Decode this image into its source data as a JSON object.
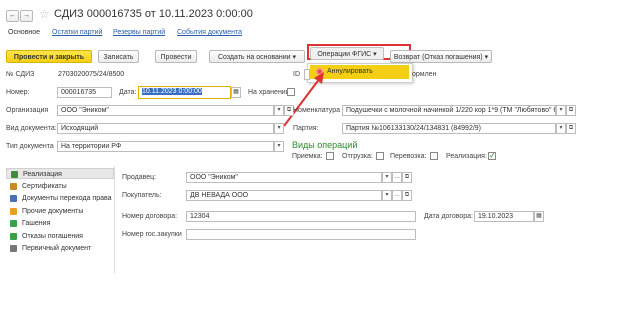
{
  "nav": {
    "back": "←",
    "forward": "→"
  },
  "title": "СДИЗ 000016735 от 10.11.2023 0:00:00",
  "tabs": [
    "Основное",
    "Остатки партий",
    "Резервы партий",
    "События документа"
  ],
  "toolbar": {
    "post_close": "Провести и закрыть",
    "save": "Записать",
    "post": "Провести",
    "create_based": "Создать на основании",
    "fgis_ops": "Операции ФГИС",
    "return": "Возврат (Отказ погашения)"
  },
  "dropdown": {
    "cancel": "Аннулировать"
  },
  "form": {
    "sdiz_label": "№ СДИЗ",
    "sdiz_value": "2703020075/24/8500",
    "id_label": "ID",
    "id_tail": "ормлен",
    "number_label": "Номер:",
    "number_value": "000016735",
    "date_label": "Дата:",
    "date_value": "10.11.2023  0:00:00",
    "storage_label": "На хранении:",
    "org_label": "Организация",
    "org_value": "ООО \"Эником\"",
    "nomen_label": "Номенклатура",
    "nomen_value": "Подушечки с молочной начинкой 1/220 кор 1*9 (ТМ \"Любятово\" 6",
    "doctype_label": "Вид документа:",
    "doctype_value": "Исходящий",
    "batch_label": "Партия:",
    "batch_value": "Партия №106133130/24/134831 (84992/9)",
    "type_label": "Тип документа",
    "type_value": "На территории РФ",
    "ops_title": "Виды операций",
    "op_accept": "Приемка:",
    "op_ship": "Отгрузка:",
    "op_transport": "Перевозка:",
    "op_sale": "Реализация:"
  },
  "sidebar": [
    {
      "label": "Реализация",
      "color": "#3e8e3e"
    },
    {
      "label": "Сертификаты",
      "color": "#c98a2a"
    },
    {
      "label": "Документы перехода права",
      "color": "#4a6fb5"
    },
    {
      "label": "Прочие документы",
      "color": "#e8a020"
    },
    {
      "label": "Гашения",
      "color": "#3aa04a"
    },
    {
      "label": "Отказы погашения",
      "color": "#3aa04a"
    },
    {
      "label": "Первичный документ",
      "color": "#777777"
    }
  ],
  "detail": {
    "seller_label": "Продавец:",
    "seller_value": "ООО \"Эником\"",
    "buyer_label": "Покупатель:",
    "buyer_value": "ДВ НЕВАДА ООО",
    "contract_label": "Номер договора:",
    "contract_value": "12304",
    "contract_date_label": "Дата договора:",
    "contract_date_value": "19.10.2023",
    "gov_label": "Номер гос.закупки"
  },
  "colors": {
    "accent": "#f5cf13",
    "highlight": "#d33",
    "link": "#2a5ea8",
    "ops_title": "#2e8b2e"
  }
}
